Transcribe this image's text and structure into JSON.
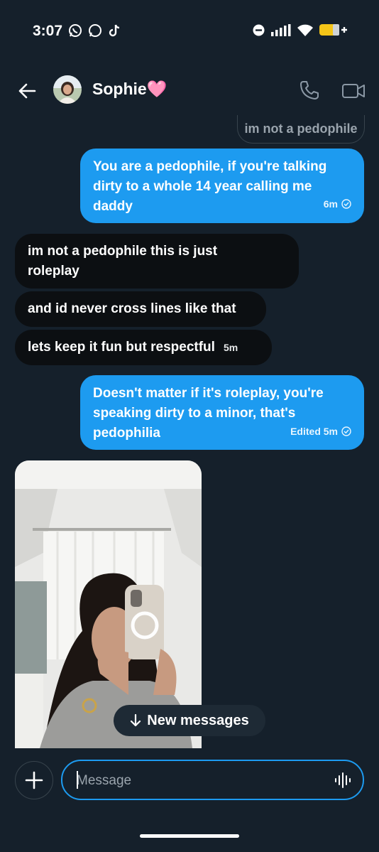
{
  "status_bar": {
    "time": "3:07"
  },
  "header": {
    "contact_name": "Sophie",
    "heart": "🩷"
  },
  "reply_preview": "im not a pedophile",
  "messages": [
    {
      "direction": "out",
      "text": "You are a pedophile, if you're talking dirty to a whole 14 year calling me daddy",
      "meta": "6m"
    },
    {
      "direction": "in",
      "text": "im not a pedophile this is just roleplay"
    },
    {
      "direction": "in",
      "text": "and id never cross lines like that"
    },
    {
      "direction": "in",
      "text": "lets keep it fun but respectful",
      "meta": "5m"
    },
    {
      "direction": "out",
      "text": "Doesn't matter if it's roleplay, you're speaking dirty to a minor, that's pedophilia",
      "meta": "Edited 5m"
    }
  ],
  "new_messages_label": "New messages",
  "compose": {
    "placeholder": "Message"
  },
  "colors": {
    "background": "#15202b",
    "accent": "#1d9bf0",
    "incoming_bubble": "#0c0f12"
  },
  "icons": [
    "whatsapp-icon",
    "chat-icon",
    "tiktok-icon",
    "dnd-icon",
    "signal-icon",
    "wifi-icon",
    "battery-icon",
    "back-arrow-icon",
    "phone-icon",
    "video-icon",
    "check-circle-icon",
    "arrow-down-icon",
    "plus-icon",
    "voice-icon"
  ]
}
